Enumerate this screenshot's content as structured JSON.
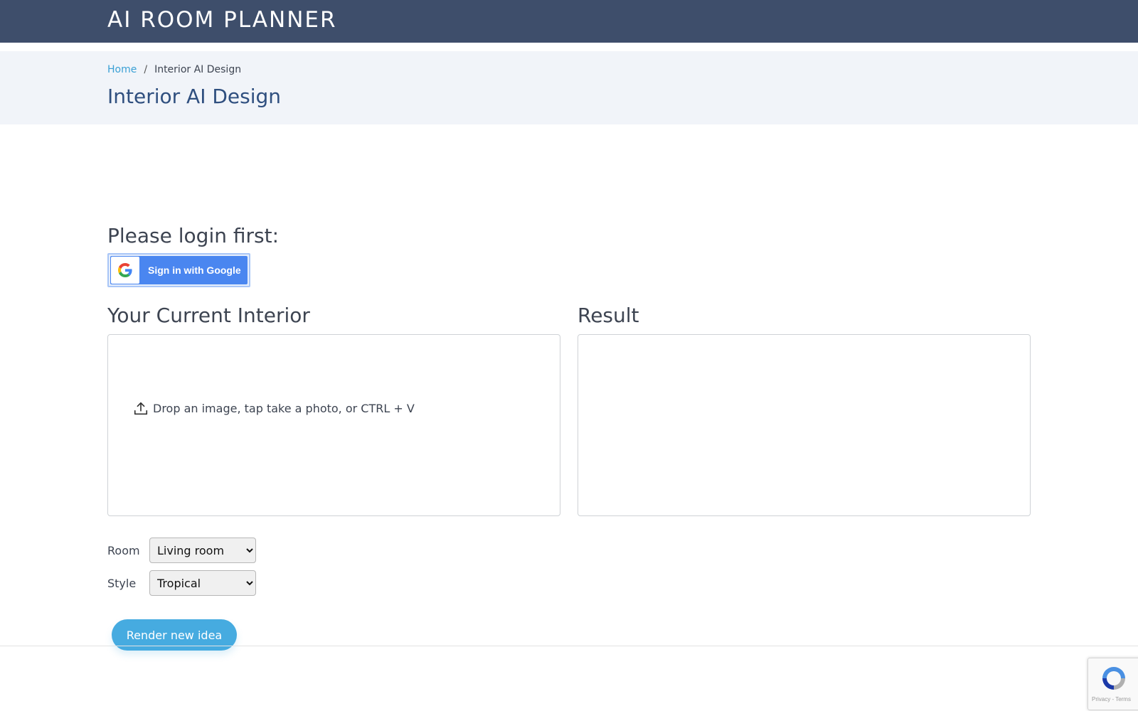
{
  "header": {
    "logo_text": "AI ROOM PLANNER"
  },
  "breadcrumb": {
    "home": "Home",
    "separator": "/",
    "current": "Interior AI Design"
  },
  "page": {
    "title": "Interior AI Design"
  },
  "login": {
    "heading": "Please login first:",
    "google_button_label": "Sign in with Google"
  },
  "sections": {
    "current_heading": "Your Current Interior",
    "result_heading": "Result"
  },
  "dropzone": {
    "text": "Drop an image, tap take a photo, or CTRL + V",
    "icon": "upload-icon"
  },
  "form": {
    "room_label": "Room",
    "room_selected": "Living room",
    "style_label": "Style",
    "style_selected": "Tropical"
  },
  "actions": {
    "render_label": "Render new idea"
  },
  "recaptcha": {
    "links": "Privacy - Terms"
  },
  "colors": {
    "header_bg": "#3e4e6b",
    "title_band_bg": "#f1f4f9",
    "page_title": "#2f4f7f",
    "link": "#3aa0d5",
    "google_blue": "#4a86f0",
    "render_button": "#46abe0"
  }
}
